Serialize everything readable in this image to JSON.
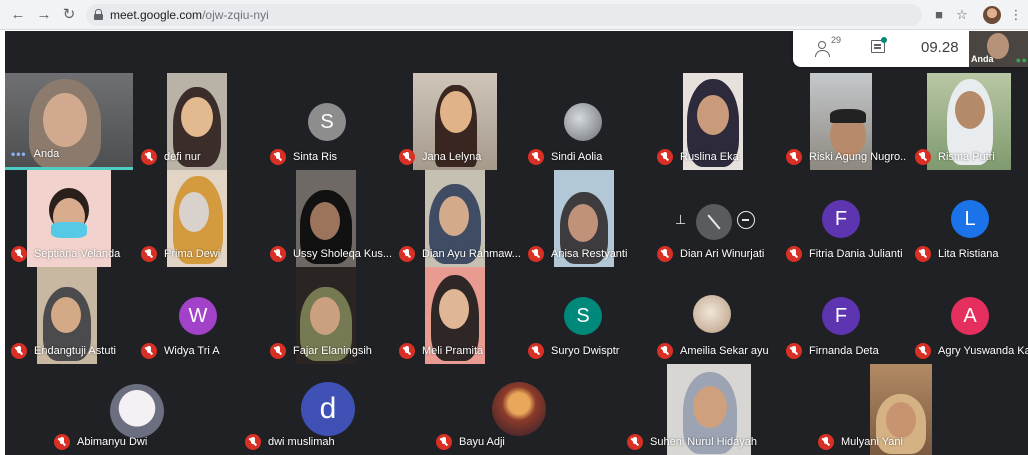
{
  "browser": {
    "url_host": "meet.google.com",
    "url_path": "/ojw-zqiu-nyi"
  },
  "topbar": {
    "people_count": "29",
    "clock": "09.28",
    "self_label": "Anda"
  },
  "participants": [
    "Anda",
    "defi nur",
    "Sinta Ris",
    "Jana Lelyna",
    "Sindi Aolia",
    "Ruslina Eka",
    "Riski Agung Nugro...",
    "Risma Putri",
    "Septiana Velanda",
    "Prima Dewi",
    "Ussy Sholeqa Kus...",
    "Dian Ayu Rahmaw...",
    "Anisa Restyanti",
    "Dian Ari Winurjati",
    "Fitria Dania Julianti",
    "Lita Ristiana",
    "Endangtuji Astuti",
    "Widya Tri A",
    "Fajar Elaningsih",
    "Meli Pramita",
    "Suryo Dwisptr",
    "Ameilia Sekar ayu",
    "Firnanda Deta",
    "Agry Yuswanda Ka...",
    "Abimanyu Dwi",
    "dwi muslimah",
    "Bayu Adji",
    "Suheni Nurul Hidayah",
    "Mulyani Yani"
  ],
  "avatars": {
    "sinta": {
      "letter": "S",
      "color": "#8d8d8d"
    },
    "fitria": {
      "letter": "F",
      "color": "#5e35b1"
    },
    "lita": {
      "letter": "L",
      "color": "#1a73e8"
    },
    "widya": {
      "letter": "W",
      "color": "#a142c9"
    },
    "suryo": {
      "letter": "S",
      "color": "#00897b"
    },
    "firnanda": {
      "letter": "F",
      "color": "#5e35b1"
    },
    "agry": {
      "letter": "A",
      "color": "#e52f5e"
    },
    "dwi": {
      "letter": "d",
      "color": "#3f51b5"
    }
  },
  "colors": {
    "stage_bg": "#202124",
    "mute_red": "#d93025",
    "active_speaker": "#4ecdc4"
  }
}
